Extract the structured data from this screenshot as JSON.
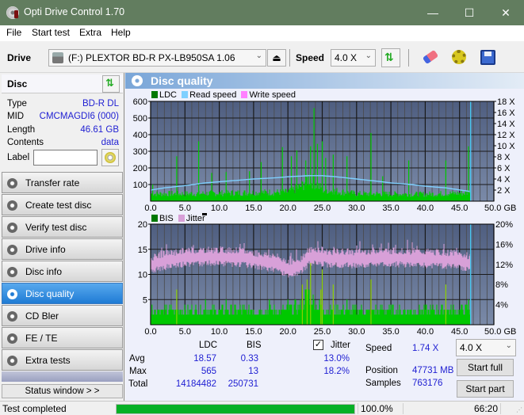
{
  "window": {
    "title": "Opti Drive Control 1.70",
    "controls": {
      "minimize": "—",
      "maximize": "☐",
      "close": "✕"
    }
  },
  "menu": [
    "File",
    "Start test",
    "Extra",
    "Help"
  ],
  "toolbar": {
    "drive_label": "Drive",
    "drive_value": "(F:)  PLEXTOR BD-R  PX-LB950SA 1.06",
    "speed_label": "Speed",
    "speed_value": "4.0 X",
    "icons": [
      "eject-icon",
      "refresh-icon",
      "erase-icon",
      "settings-icon",
      "save-icon"
    ]
  },
  "disc": {
    "header": "Disc",
    "type_label": "Type",
    "type_value": "BD-R DL",
    "mid_label": "MID",
    "mid_value": "CMCMAGDI6 (000)",
    "length_label": "Length",
    "length_value": "46.61 GB",
    "contents_label": "Contents",
    "contents_value": "data",
    "label_label": "Label",
    "label_value": ""
  },
  "nav": [
    {
      "label": "Transfer rate",
      "active": false
    },
    {
      "label": "Create test disc",
      "active": false
    },
    {
      "label": "Verify test disc",
      "active": false
    },
    {
      "label": "Drive info",
      "active": false
    },
    {
      "label": "Disc info",
      "active": false
    },
    {
      "label": "Disc quality",
      "active": true
    },
    {
      "label": "CD Bler",
      "active": false
    },
    {
      "label": "FE / TE",
      "active": false
    },
    {
      "label": "Extra tests",
      "active": false
    }
  ],
  "status_window_button": "Status window > >",
  "panel": {
    "title": "Disc quality"
  },
  "colors": {
    "ldc": "#00c800",
    "bis": "#00c800",
    "read_speed": "#7fd0ff",
    "write_speed": "#ff80ff",
    "jitter": "#d8a0d8",
    "plot_bg_top": "#4f5e80",
    "plot_bg_bottom": "#7a8aa8",
    "accent": "#1f7bd4",
    "progress": "#06b025"
  },
  "chart_data": [
    {
      "type": "bar",
      "title": "LDC / Read speed",
      "legend": [
        "LDC",
        "Read speed",
        "Write speed"
      ],
      "legend_placement": "top-left",
      "xlabel": "GB",
      "x_ticks": [
        "0.0",
        "5.0",
        "10.0",
        "15.0",
        "20.0",
        "25.0",
        "30.0",
        "35.0",
        "40.0",
        "45.0",
        "50.0 GB"
      ],
      "xlim": [
        0,
        50
      ],
      "ylim_left": [
        0,
        600
      ],
      "y_ticks_left": [
        "100",
        "200",
        "300",
        "400",
        "500",
        "600"
      ],
      "ylim_right": [
        0,
        18
      ],
      "y_ticks_right": [
        "2 X",
        "4 X",
        "6 X",
        "8 X",
        "10 X",
        "12 X",
        "14 X",
        "16 X",
        "18 X"
      ],
      "grid": true,
      "end_marker_gb": 46.61,
      "ldc_baseline": [
        [
          0,
          45
        ],
        [
          5,
          45
        ],
        [
          10,
          48
        ],
        [
          15,
          52
        ],
        [
          20,
          55
        ],
        [
          22,
          90
        ],
        [
          23,
          140
        ],
        [
          24,
          110
        ],
        [
          25,
          70
        ],
        [
          30,
          45
        ],
        [
          40,
          42
        ],
        [
          46.5,
          50
        ]
      ],
      "ldc_spikes": [
        [
          0.3,
          100
        ],
        [
          3.8,
          270
        ],
        [
          7.0,
          360
        ],
        [
          8.9,
          170
        ],
        [
          11.0,
          175
        ],
        [
          14.4,
          180
        ],
        [
          16.1,
          235
        ],
        [
          19.2,
          325
        ],
        [
          20.5,
          270
        ],
        [
          21.3,
          305
        ],
        [
          22.6,
          245
        ],
        [
          23.3,
          330
        ],
        [
          23.8,
          560
        ],
        [
          24.3,
          345
        ],
        [
          25.0,
          360
        ],
        [
          25.5,
          260
        ],
        [
          26.6,
          280
        ],
        [
          28.6,
          270
        ],
        [
          32.1,
          410
        ],
        [
          33.8,
          150
        ],
        [
          37.6,
          245
        ],
        [
          43.0,
          245
        ],
        [
          46.3,
          330
        ]
      ],
      "read_speed": [
        [
          0,
          2.0
        ],
        [
          2,
          2.4
        ],
        [
          5,
          2.8
        ],
        [
          8,
          3.3
        ],
        [
          10,
          3.5
        ],
        [
          13,
          3.8
        ],
        [
          15,
          4.0
        ],
        [
          18,
          4.2
        ],
        [
          20,
          4.4
        ],
        [
          23,
          4.6
        ],
        [
          25,
          4.6
        ],
        [
          27,
          4.4
        ],
        [
          30,
          4.0
        ],
        [
          33,
          3.6
        ],
        [
          35,
          3.3
        ],
        [
          38,
          3.0
        ],
        [
          40,
          2.7
        ],
        [
          43,
          2.4
        ],
        [
          46.6,
          1.74
        ]
      ]
    },
    {
      "type": "bar",
      "title": "BIS / Jitter",
      "legend": [
        "BIS",
        "Jitter"
      ],
      "legend_placement": "top-left",
      "xlabel": "GB",
      "x_ticks": [
        "0.0",
        "5.0",
        "10.0",
        "15.0",
        "20.0",
        "25.0",
        "30.0",
        "35.0",
        "40.0",
        "45.0",
        "50.0 GB"
      ],
      "xlim": [
        0,
        50
      ],
      "ylim_left": [
        0,
        20
      ],
      "y_ticks_left": [
        "5",
        "10",
        "15",
        "20"
      ],
      "ylim_right": [
        0,
        20
      ],
      "y_ticks_right": [
        "4%",
        "8%",
        "12%",
        "16%",
        "20%"
      ],
      "grid": true,
      "end_marker_gb": 46.61,
      "bis_baseline": [
        [
          0,
          3
        ],
        [
          10,
          3
        ],
        [
          20,
          3
        ],
        [
          22,
          4
        ],
        [
          23,
          7
        ],
        [
          24,
          4
        ],
        [
          26,
          3
        ],
        [
          46.5,
          3
        ]
      ],
      "bis_spikes": [
        [
          0.2,
          4
        ],
        [
          3.8,
          7
        ],
        [
          8.0,
          5
        ],
        [
          11.0,
          5
        ],
        [
          17.3,
          5
        ],
        [
          20.0,
          5
        ],
        [
          22.1,
          8
        ],
        [
          22.8,
          9
        ],
        [
          23.3,
          13
        ],
        [
          24.8,
          7
        ],
        [
          25.0,
          11
        ],
        [
          26.6,
          8
        ],
        [
          28.6,
          5
        ],
        [
          32.1,
          9
        ],
        [
          43.0,
          8
        ],
        [
          46.3,
          5
        ]
      ],
      "jitter_percent": [
        [
          0,
          12.0
        ],
        [
          2,
          12.8
        ],
        [
          5,
          13.4
        ],
        [
          8,
          13.6
        ],
        [
          10,
          13.6
        ],
        [
          13,
          13.4
        ],
        [
          15,
          13.0
        ],
        [
          18,
          12.4
        ],
        [
          20,
          11.3
        ],
        [
          21,
          11.2
        ],
        [
          22,
          12.0
        ],
        [
          23,
          13.5
        ],
        [
          24,
          13.8
        ],
        [
          26,
          13.2
        ],
        [
          30,
          13.2
        ],
        [
          33,
          13.4
        ],
        [
          36,
          13.4
        ],
        [
          40,
          13.2
        ],
        [
          44,
          13.0
        ],
        [
          46.6,
          12.3
        ]
      ]
    }
  ],
  "stats": {
    "col_ldc": "LDC",
    "col_bis": "BIS",
    "jitter_label": "Jitter",
    "jitter_checked": true,
    "avg_label": "Avg",
    "avg_ldc": "18.57",
    "avg_bis": "0.33",
    "avg_jitter": "13.0%",
    "max_label": "Max",
    "max_ldc": "565",
    "max_bis": "13",
    "max_jitter": "18.2%",
    "total_label": "Total",
    "total_ldc": "14184482",
    "total_bis": "250731",
    "speed_label": "Speed",
    "speed_value": "1.74 X",
    "position_label": "Position",
    "position_value": "47731 MB",
    "samples_label": "Samples",
    "samples_value": "763176",
    "speed_select": "4.0 X",
    "start_full": "Start full",
    "start_part": "Start part"
  },
  "statusbar": {
    "text": "Test completed",
    "progress_percent": 100.0,
    "progress_label": "100.0%",
    "time": "66:20"
  }
}
